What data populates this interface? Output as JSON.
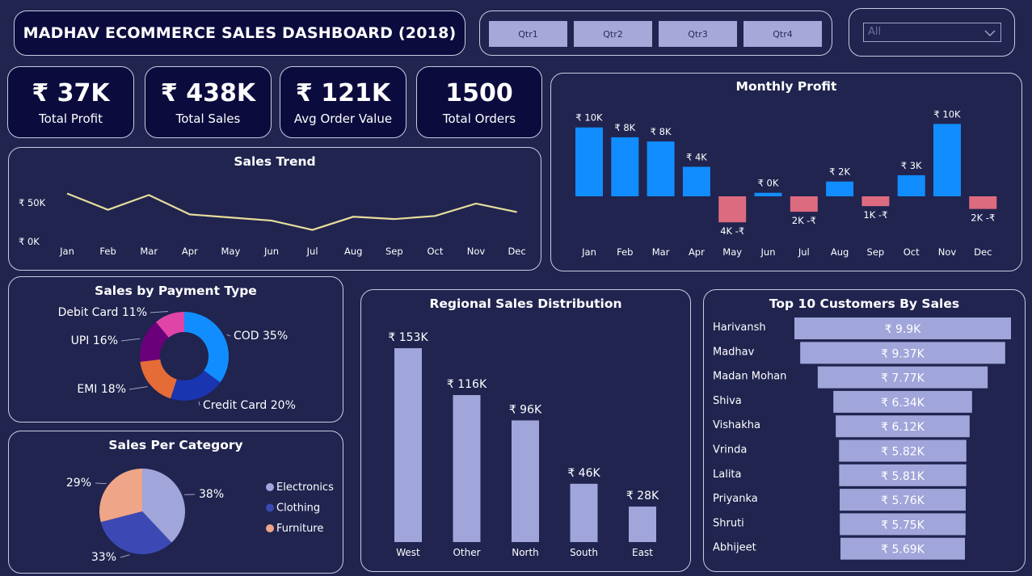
{
  "header": {
    "title": "MADHAV ECOMMERCE SALES DASHBOARD (2018)"
  },
  "slicer": {
    "quarters": [
      "Qtr1",
      "Qtr2",
      "Qtr3",
      "Qtr4"
    ],
    "dropdown_value": "All"
  },
  "kpis": [
    {
      "value": "₹ 37K",
      "label": "Total Profit"
    },
    {
      "value": "₹ 438K",
      "label": "Total Sales"
    },
    {
      "value": "₹ 121K",
      "label": "Avg Order Value"
    },
    {
      "value": "1500",
      "label": "Total Orders"
    }
  ],
  "colors": {
    "background": "#20244f",
    "kpi_bg": "#0b0b3e",
    "positive": "#118dff",
    "negative": "#dd6b7f",
    "lavender": "#a0a5da",
    "trend_line": "#e8dd9c"
  },
  "chart_data": [
    {
      "id": "sales_trend",
      "type": "line",
      "title": "Sales Trend",
      "categories": [
        "Jan",
        "Feb",
        "Mar",
        "Apr",
        "May",
        "Jun",
        "Jul",
        "Aug",
        "Sep",
        "Oct",
        "Nov",
        "Dec"
      ],
      "values": [
        62,
        41,
        60,
        35,
        31,
        27,
        15,
        32,
        29,
        33,
        49,
        38
      ],
      "ytick_labels": [
        "₹ 0K",
        "₹ 50K"
      ],
      "yticks": [
        0,
        50
      ],
      "ylim": [
        0,
        70
      ],
      "unit": "K"
    },
    {
      "id": "monthly_profit",
      "type": "bar",
      "title": "Monthly Profit",
      "categories": [
        "Jan",
        "Feb",
        "Mar",
        "Apr",
        "May",
        "Jun",
        "Jul",
        "Aug",
        "Sep",
        "Oct",
        "Nov",
        "Dec"
      ],
      "values": [
        9.8,
        8.4,
        7.8,
        4.2,
        -3.7,
        0.5,
        -2.2,
        2.1,
        -1.4,
        3.0,
        10.3,
        -1.8
      ],
      "data_labels": [
        "₹ 10K",
        "₹ 8K",
        "₹ 8K",
        "₹ 4K",
        "4K -₹",
        "₹ 0K",
        "2K -₹",
        "₹ 2K",
        "1K -₹",
        "₹ 3K",
        "₹ 10K",
        "2K -₹"
      ],
      "ylim": [
        -4.5,
        11
      ]
    },
    {
      "id": "sales_by_payment",
      "type": "pie",
      "title": "Sales by Payment Type",
      "donut": true,
      "slices": [
        {
          "label": "COD 35%",
          "value": 35,
          "color": "#118dff"
        },
        {
          "label": "Credit Card 20%",
          "value": 20,
          "color": "#1a35b0"
        },
        {
          "label": "EMI 18%",
          "value": 18,
          "color": "#e66c37"
        },
        {
          "label": "UPI 16%",
          "value": 16,
          "color": "#6b007b"
        },
        {
          "label": "Debit Card 11%",
          "value": 11,
          "color": "#e044a7"
        }
      ]
    },
    {
      "id": "sales_per_category",
      "type": "pie",
      "title": "Sales Per Category",
      "slices": [
        {
          "label": "38%",
          "name": "Electronics",
          "value": 38,
          "color": "#a0a5da"
        },
        {
          "label": "33%",
          "name": "Clothing",
          "value": 33,
          "color": "#3c49b4"
        },
        {
          "label": "29%",
          "name": "Furniture",
          "value": 29,
          "color": "#efa587"
        }
      ],
      "legend": "right"
    },
    {
      "id": "regional_sales",
      "type": "bar",
      "title": "Regional Sales Distribution",
      "categories": [
        "West",
        "Other",
        "North",
        "South",
        "East"
      ],
      "values": [
        153,
        116,
        96,
        46,
        28
      ],
      "data_labels": [
        "₹ 153K",
        "₹ 116K",
        "₹ 96K",
        "₹ 46K",
        "₹ 28K"
      ],
      "ylim": [
        0,
        160
      ]
    },
    {
      "id": "top_customers",
      "type": "bar",
      "orientation": "funnel",
      "title": "Top 10 Customers By Sales",
      "categories": [
        "Harivansh",
        "Madhav",
        "Madan Mohan",
        "Shiva",
        "Vishakha",
        "Vrinda",
        "Lalita",
        "Priyanka",
        "Shruti",
        "Abhijeet"
      ],
      "values": [
        9.9,
        9.37,
        7.77,
        6.34,
        6.12,
        5.82,
        5.81,
        5.76,
        5.75,
        5.69
      ],
      "data_labels": [
        "₹ 9.9K",
        "₹ 9.37K",
        "₹ 7.77K",
        "₹ 6.34K",
        "₹ 6.12K",
        "₹ 5.82K",
        "₹ 5.81K",
        "₹ 5.76K",
        "₹ 5.75K",
        "₹ 5.69K"
      ]
    }
  ]
}
